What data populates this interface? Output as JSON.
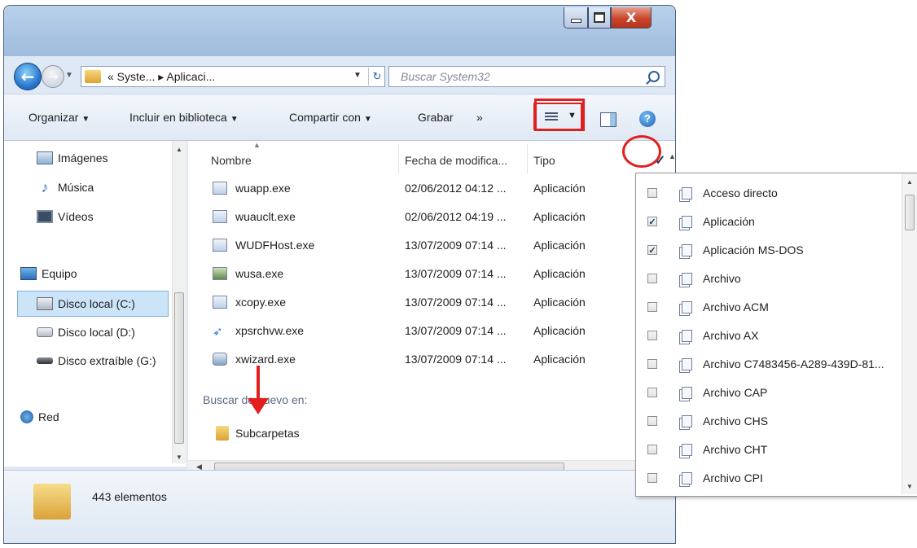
{
  "address": {
    "path": "« Syste... ▸ Aplicaci...",
    "refresh_glyph": "↻"
  },
  "search": {
    "placeholder": "Buscar System32"
  },
  "window_buttons": {
    "close": "X"
  },
  "toolbar": {
    "organize": "Organizar",
    "include": "Incluir en biblioteca",
    "share": "Compartir con",
    "burn": "Grabar",
    "more": "»",
    "help": "?"
  },
  "nav": {
    "items": [
      {
        "label": "Imágenes",
        "icon": "pictures-icon"
      },
      {
        "label": "Música",
        "icon": "music-icon"
      },
      {
        "label": "Vídeos",
        "icon": "videos-icon"
      },
      {
        "label": "Equipo",
        "icon": "computer-icon"
      },
      {
        "label": "Disco local (C:)",
        "icon": "disk-c-icon"
      },
      {
        "label": "Disco local (D:)",
        "icon": "disk-d-icon"
      },
      {
        "label": "Disco extraíble (G:)",
        "icon": "removable-disk-icon"
      },
      {
        "label": "Red",
        "icon": "network-icon"
      }
    ]
  },
  "columns": {
    "name": "Nombre",
    "date": "Fecha de modifica...",
    "type": "Tipo"
  },
  "files": [
    {
      "name": "wuapp.exe",
      "date": "02/06/2012 04:12 ...",
      "type": "Aplicación"
    },
    {
      "name": "wuauclt.exe",
      "date": "02/06/2012 04:19 ...",
      "type": "Aplicación"
    },
    {
      "name": "WUDFHost.exe",
      "date": "13/07/2009 07:14 ...",
      "type": "Aplicación"
    },
    {
      "name": "wusa.exe",
      "date": "13/07/2009 07:14 ...",
      "type": "Aplicación"
    },
    {
      "name": "xcopy.exe",
      "date": "13/07/2009 07:14 ...",
      "type": "Aplicación"
    },
    {
      "name": "xpsrchvw.exe",
      "date": "13/07/2009 07:14 ...",
      "type": "Aplicación"
    },
    {
      "name": "xwizard.exe",
      "date": "13/07/2009 07:14 ...",
      "type": "Aplicación"
    }
  ],
  "search_again": {
    "label": "Buscar de nuevo en:",
    "subfolders": "Subcarpetas"
  },
  "details": {
    "count": "443 elementos"
  },
  "filter": {
    "options": [
      {
        "label": "Acceso directo",
        "checked": false
      },
      {
        "label": "Aplicación",
        "checked": true
      },
      {
        "label": "Aplicación MS-DOS",
        "checked": true
      },
      {
        "label": "Archivo",
        "checked": false
      },
      {
        "label": "Archivo ACM",
        "checked": false
      },
      {
        "label": "Archivo AX",
        "checked": false
      },
      {
        "label": "Archivo C7483456-A289-439D-81...",
        "checked": false
      },
      {
        "label": "Archivo CAP",
        "checked": false
      },
      {
        "label": "Archivo CHS",
        "checked": false
      },
      {
        "label": "Archivo CHT",
        "checked": false
      },
      {
        "label": "Archivo CPI",
        "checked": false
      }
    ]
  },
  "colors": {
    "annotation": "#e11f1f",
    "selection": "#cce4f7"
  }
}
